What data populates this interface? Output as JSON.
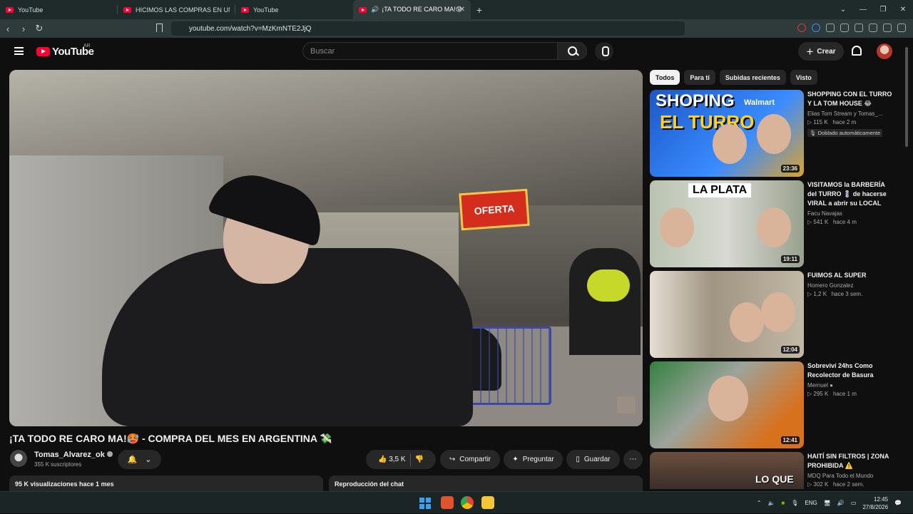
{
  "browser": {
    "tabs": [
      {
        "title": "YouTube"
      },
      {
        "title": "HICIMOS LAS COMPRAS EN UN MA"
      },
      {
        "title": "YouTube"
      },
      {
        "title": "¡TA TODO RE CARO MA!😰"
      }
    ],
    "url": "youtube.com/watch?v=MzKmNTE2JjQ"
  },
  "header": {
    "logo": "YouTube",
    "country": "AR",
    "search_placeholder": "Buscar",
    "create_label": "Crear"
  },
  "video": {
    "title": "¡TA TODO RE CARO MA!🥵 - COMPRA DEL MES EN ARGENTINA 💸",
    "overlay_sign": "OFERTA",
    "channel": "Tomas_Alvarez_ok",
    "subscribers": "355 K suscriptores",
    "likes": "3,5 K",
    "share": "Compartir",
    "ask": "Preguntar",
    "save": "Guardar",
    "views": "95 K visualizaciones  hace 1 mes",
    "chat_replay": "Reproducción del chat"
  },
  "filters": [
    "Todos",
    "Para ti",
    "Subidas recientes",
    "Visto"
  ],
  "recommendations": [
    {
      "title": "SHOPPING CON EL TURRO Y LA TOM HOUSE 😂",
      "channel": "Elias Tom Stream  y Tomas_...",
      "views": "115 K",
      "age": "hace 2 m",
      "duration": "23:36",
      "badge": "Doblado automáticamente",
      "thumb_text_1": "SHOPING",
      "thumb_text_2": "EL TURRO",
      "thumb_text_3": "Walmart"
    },
    {
      "title": "VISITAMOS la BARBERÍA del TURRO 💈 de hacerse VIRAL a abrir su LOCAL",
      "channel": "Facu Navajas",
      "views": "541 K",
      "age": "hace 4 m",
      "duration": "19:11",
      "thumb_text_1": "LA PLATA"
    },
    {
      "title": "FUIMOS AL SUPER",
      "channel": "Homero Gonzalez",
      "views": "1,2 K",
      "age": "hace 3 sem.",
      "duration": "12:04"
    },
    {
      "title": "Sobreviví 24hs Como Recolector de Basura",
      "channel": "Mernuel",
      "views": "295 K",
      "age": "hace 1 m",
      "duration": "12:41"
    },
    {
      "title": "HAITÍ SIN FILTROS | ZONA PROHIBIDA ⚠️",
      "channel": "MDQ Para Todo el Mundo",
      "views": "302 K",
      "age": "hace 2 sem.",
      "thumb_text_1": "LO QUE"
    }
  ],
  "taskbar": {
    "lang": "ENG",
    "time": "12:45",
    "date": "27/8/2026"
  }
}
